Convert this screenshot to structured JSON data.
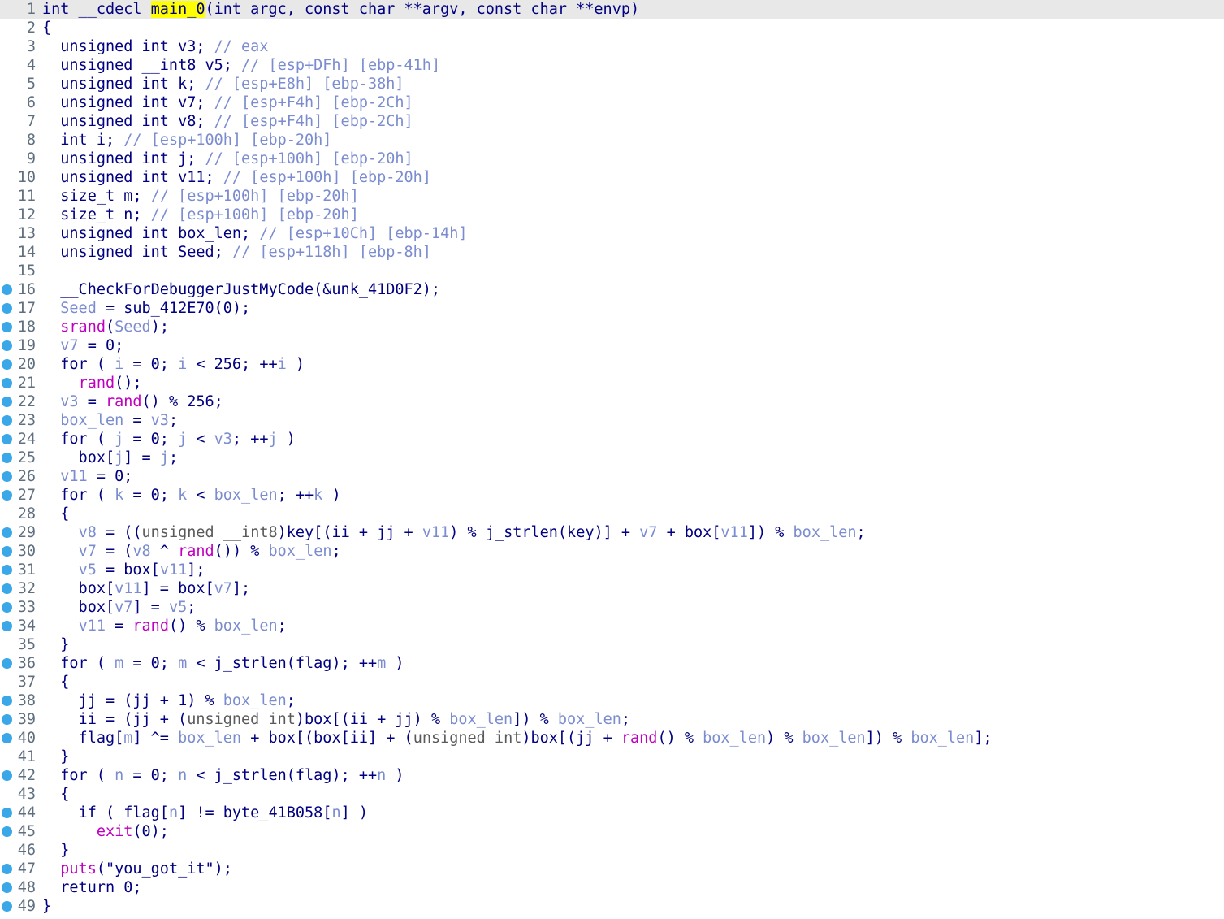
{
  "editor": {
    "current_line": 1,
    "lines": [
      {
        "n": "1",
        "bp": false,
        "t": [
          [
            "k",
            "int __cdecl "
          ],
          [
            "hl",
            "main_0"
          ],
          [
            "k",
            "(int argc, const char **argv, const char **envp)"
          ]
        ]
      },
      {
        "n": "2",
        "bp": false,
        "t": [
          [
            "k",
            "{"
          ]
        ]
      },
      {
        "n": "3",
        "bp": false,
        "t": [
          [
            "k",
            "  unsigned int v3; "
          ],
          [
            "cm",
            "// eax"
          ]
        ]
      },
      {
        "n": "4",
        "bp": false,
        "t": [
          [
            "k",
            "  unsigned __int8 v5; "
          ],
          [
            "cm",
            "// [esp+DFh] [ebp-41h]"
          ]
        ]
      },
      {
        "n": "5",
        "bp": false,
        "t": [
          [
            "k",
            "  unsigned int k; "
          ],
          [
            "cm",
            "// [esp+E8h] [ebp-38h]"
          ]
        ]
      },
      {
        "n": "6",
        "bp": false,
        "t": [
          [
            "k",
            "  unsigned int v7; "
          ],
          [
            "cm",
            "// [esp+F4h] [ebp-2Ch]"
          ]
        ]
      },
      {
        "n": "7",
        "bp": false,
        "t": [
          [
            "k",
            "  unsigned int v8; "
          ],
          [
            "cm",
            "// [esp+F4h] [ebp-2Ch]"
          ]
        ]
      },
      {
        "n": "8",
        "bp": false,
        "t": [
          [
            "k",
            "  int i; "
          ],
          [
            "cm",
            "// [esp+100h] [ebp-20h]"
          ]
        ]
      },
      {
        "n": "9",
        "bp": false,
        "t": [
          [
            "k",
            "  unsigned int j; "
          ],
          [
            "cm",
            "// [esp+100h] [ebp-20h]"
          ]
        ]
      },
      {
        "n": "10",
        "bp": false,
        "t": [
          [
            "k",
            "  unsigned int v11; "
          ],
          [
            "cm",
            "// [esp+100h] [ebp-20h]"
          ]
        ]
      },
      {
        "n": "11",
        "bp": false,
        "t": [
          [
            "k",
            "  size_t m; "
          ],
          [
            "cm",
            "// [esp+100h] [ebp-20h]"
          ]
        ]
      },
      {
        "n": "12",
        "bp": false,
        "t": [
          [
            "k",
            "  size_t n; "
          ],
          [
            "cm",
            "// [esp+100h] [ebp-20h]"
          ]
        ]
      },
      {
        "n": "13",
        "bp": false,
        "t": [
          [
            "k",
            "  unsigned int box_len; "
          ],
          [
            "cm",
            "// [esp+10Ch] [ebp-14h]"
          ]
        ]
      },
      {
        "n": "14",
        "bp": false,
        "t": [
          [
            "k",
            "  unsigned int Seed; "
          ],
          [
            "cm",
            "// [esp+118h] [ebp-8h]"
          ]
        ]
      },
      {
        "n": "15",
        "bp": false,
        "t": []
      },
      {
        "n": "16",
        "bp": true,
        "t": [
          [
            "k",
            "  __CheckForDebuggerJustMyCode(&unk_41D0F2);"
          ]
        ]
      },
      {
        "n": "17",
        "bp": true,
        "t": [
          [
            "k",
            "  "
          ],
          [
            "lv",
            "Seed"
          ],
          [
            "k",
            " = sub_412E70(0);"
          ]
        ]
      },
      {
        "n": "18",
        "bp": true,
        "t": [
          [
            "k",
            "  "
          ],
          [
            "f",
            "srand"
          ],
          [
            "k",
            "("
          ],
          [
            "lv",
            "Seed"
          ],
          [
            "k",
            ");"
          ]
        ]
      },
      {
        "n": "19",
        "bp": true,
        "t": [
          [
            "k",
            "  "
          ],
          [
            "lv",
            "v7"
          ],
          [
            "k",
            " = 0;"
          ]
        ]
      },
      {
        "n": "20",
        "bp": true,
        "t": [
          [
            "k",
            "  for ( "
          ],
          [
            "lv",
            "i"
          ],
          [
            "k",
            " = 0; "
          ],
          [
            "lv",
            "i"
          ],
          [
            "k",
            " < 256; ++"
          ],
          [
            "lv",
            "i"
          ],
          [
            "k",
            " )"
          ]
        ]
      },
      {
        "n": "21",
        "bp": true,
        "t": [
          [
            "k",
            "    "
          ],
          [
            "f",
            "rand"
          ],
          [
            "k",
            "();"
          ]
        ]
      },
      {
        "n": "22",
        "bp": true,
        "t": [
          [
            "k",
            "  "
          ],
          [
            "lv",
            "v3"
          ],
          [
            "k",
            " = "
          ],
          [
            "f",
            "rand"
          ],
          [
            "k",
            "() % 256;"
          ]
        ]
      },
      {
        "n": "23",
        "bp": true,
        "t": [
          [
            "k",
            "  "
          ],
          [
            "lv",
            "box_len"
          ],
          [
            "k",
            " = "
          ],
          [
            "lv",
            "v3"
          ],
          [
            "k",
            ";"
          ]
        ]
      },
      {
        "n": "24",
        "bp": true,
        "t": [
          [
            "k",
            "  for ( "
          ],
          [
            "lv",
            "j"
          ],
          [
            "k",
            " = 0; "
          ],
          [
            "lv",
            "j"
          ],
          [
            "k",
            " < "
          ],
          [
            "lv",
            "v3"
          ],
          [
            "k",
            "; ++"
          ],
          [
            "lv",
            "j"
          ],
          [
            "k",
            " )"
          ]
        ]
      },
      {
        "n": "25",
        "bp": true,
        "t": [
          [
            "k",
            "    box["
          ],
          [
            "lv",
            "j"
          ],
          [
            "k",
            "] = "
          ],
          [
            "lv",
            "j"
          ],
          [
            "k",
            ";"
          ]
        ]
      },
      {
        "n": "26",
        "bp": true,
        "t": [
          [
            "k",
            "  "
          ],
          [
            "lv",
            "v11"
          ],
          [
            "k",
            " = 0;"
          ]
        ]
      },
      {
        "n": "27",
        "bp": true,
        "t": [
          [
            "k",
            "  for ( "
          ],
          [
            "lv",
            "k"
          ],
          [
            "k",
            " = 0; "
          ],
          [
            "lv",
            "k"
          ],
          [
            "k",
            " < "
          ],
          [
            "lv",
            "box_len"
          ],
          [
            "k",
            "; ++"
          ],
          [
            "lv",
            "k"
          ],
          [
            "k",
            " )"
          ]
        ]
      },
      {
        "n": "28",
        "bp": false,
        "t": [
          [
            "k",
            "  {"
          ]
        ]
      },
      {
        "n": "29",
        "bp": true,
        "t": [
          [
            "k",
            "    "
          ],
          [
            "lv",
            "v8"
          ],
          [
            "k",
            " = (("
          ],
          [
            "cs",
            "unsigned __int8"
          ],
          [
            "k",
            ")key[(ii + jj + "
          ],
          [
            "lv",
            "v11"
          ],
          [
            "k",
            ") % j_strlen(key)] + "
          ],
          [
            "lv",
            "v7"
          ],
          [
            "k",
            " + box["
          ],
          [
            "lv",
            "v11"
          ],
          [
            "k",
            "]) % "
          ],
          [
            "lv",
            "box_len"
          ],
          [
            "k",
            ";"
          ]
        ]
      },
      {
        "n": "30",
        "bp": true,
        "t": [
          [
            "k",
            "    "
          ],
          [
            "lv",
            "v7"
          ],
          [
            "k",
            " = ("
          ],
          [
            "lv",
            "v8"
          ],
          [
            "k",
            " ^ "
          ],
          [
            "f",
            "rand"
          ],
          [
            "k",
            "()) % "
          ],
          [
            "lv",
            "box_len"
          ],
          [
            "k",
            ";"
          ]
        ]
      },
      {
        "n": "31",
        "bp": true,
        "t": [
          [
            "k",
            "    "
          ],
          [
            "lv",
            "v5"
          ],
          [
            "k",
            " = box["
          ],
          [
            "lv",
            "v11"
          ],
          [
            "k",
            "];"
          ]
        ]
      },
      {
        "n": "32",
        "bp": true,
        "t": [
          [
            "k",
            "    box["
          ],
          [
            "lv",
            "v11"
          ],
          [
            "k",
            "] = box["
          ],
          [
            "lv",
            "v7"
          ],
          [
            "k",
            "];"
          ]
        ]
      },
      {
        "n": "33",
        "bp": true,
        "t": [
          [
            "k",
            "    box["
          ],
          [
            "lv",
            "v7"
          ],
          [
            "k",
            "] = "
          ],
          [
            "lv",
            "v5"
          ],
          [
            "k",
            ";"
          ]
        ]
      },
      {
        "n": "34",
        "bp": true,
        "t": [
          [
            "k",
            "    "
          ],
          [
            "lv",
            "v11"
          ],
          [
            "k",
            " = "
          ],
          [
            "f",
            "rand"
          ],
          [
            "k",
            "() % "
          ],
          [
            "lv",
            "box_len"
          ],
          [
            "k",
            ";"
          ]
        ]
      },
      {
        "n": "35",
        "bp": false,
        "t": [
          [
            "k",
            "  }"
          ]
        ]
      },
      {
        "n": "36",
        "bp": true,
        "t": [
          [
            "k",
            "  for ( "
          ],
          [
            "lv",
            "m"
          ],
          [
            "k",
            " = 0; "
          ],
          [
            "lv",
            "m"
          ],
          [
            "k",
            " < j_strlen(flag); ++"
          ],
          [
            "lv",
            "m"
          ],
          [
            "k",
            " )"
          ]
        ]
      },
      {
        "n": "37",
        "bp": false,
        "t": [
          [
            "k",
            "  {"
          ]
        ]
      },
      {
        "n": "38",
        "bp": true,
        "t": [
          [
            "k",
            "    jj = (jj + 1) % "
          ],
          [
            "lv",
            "box_len"
          ],
          [
            "k",
            ";"
          ]
        ]
      },
      {
        "n": "39",
        "bp": true,
        "t": [
          [
            "k",
            "    ii = (jj + ("
          ],
          [
            "cs",
            "unsigned int"
          ],
          [
            "k",
            ")box[(ii + jj) % "
          ],
          [
            "lv",
            "box_len"
          ],
          [
            "k",
            "]) % "
          ],
          [
            "lv",
            "box_len"
          ],
          [
            "k",
            ";"
          ]
        ]
      },
      {
        "n": "40",
        "bp": true,
        "t": [
          [
            "k",
            "    flag["
          ],
          [
            "lv",
            "m"
          ],
          [
            "k",
            "] ^= "
          ],
          [
            "lv",
            "box_len"
          ],
          [
            "k",
            " + box[(box[ii] + ("
          ],
          [
            "cs",
            "unsigned int"
          ],
          [
            "k",
            ")box[(jj + "
          ],
          [
            "f",
            "rand"
          ],
          [
            "k",
            "() % "
          ],
          [
            "lv",
            "box_len"
          ],
          [
            "k",
            ") % "
          ],
          [
            "lv",
            "box_len"
          ],
          [
            "k",
            "]) % "
          ],
          [
            "lv",
            "box_len"
          ],
          [
            "k",
            "];"
          ]
        ]
      },
      {
        "n": "41",
        "bp": false,
        "t": [
          [
            "k",
            "  }"
          ]
        ]
      },
      {
        "n": "42",
        "bp": true,
        "t": [
          [
            "k",
            "  for ( "
          ],
          [
            "lv",
            "n"
          ],
          [
            "k",
            " = 0; "
          ],
          [
            "lv",
            "n"
          ],
          [
            "k",
            " < j_strlen(flag); ++"
          ],
          [
            "lv",
            "n"
          ],
          [
            "k",
            " )"
          ]
        ]
      },
      {
        "n": "43",
        "bp": false,
        "t": [
          [
            "k",
            "  {"
          ]
        ]
      },
      {
        "n": "44",
        "bp": true,
        "t": [
          [
            "k",
            "    if ( flag["
          ],
          [
            "lv",
            "n"
          ],
          [
            "k",
            "] != byte_41B058["
          ],
          [
            "lv",
            "n"
          ],
          [
            "k",
            "] )"
          ]
        ]
      },
      {
        "n": "45",
        "bp": true,
        "t": [
          [
            "k",
            "      "
          ],
          [
            "f",
            "exit"
          ],
          [
            "k",
            "(0);"
          ]
        ]
      },
      {
        "n": "46",
        "bp": false,
        "t": [
          [
            "k",
            "  }"
          ]
        ]
      },
      {
        "n": "47",
        "bp": true,
        "t": [
          [
            "k",
            "  "
          ],
          [
            "f",
            "puts"
          ],
          [
            "k",
            "(\"you_got_it\");"
          ]
        ]
      },
      {
        "n": "48",
        "bp": true,
        "t": [
          [
            "k",
            "  return 0;"
          ]
        ]
      },
      {
        "n": "49",
        "bp": true,
        "t": [
          [
            "k",
            "}"
          ]
        ]
      }
    ]
  }
}
